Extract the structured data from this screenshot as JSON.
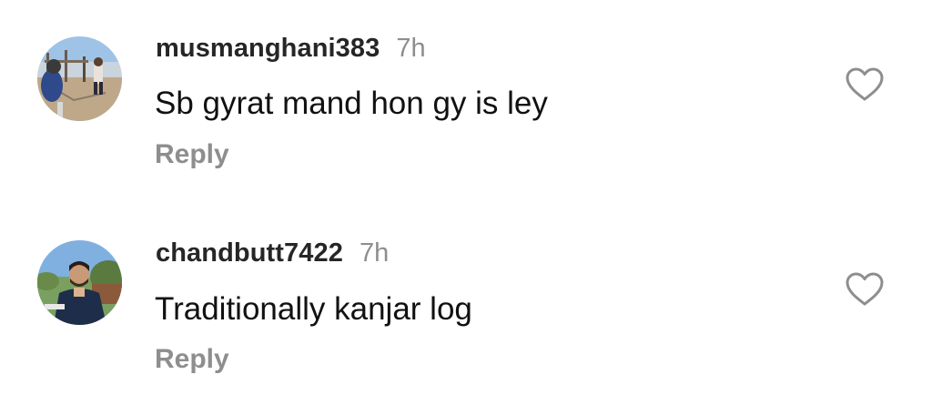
{
  "comments": [
    {
      "username": "musmanghani383",
      "time": "7h",
      "text": "Sb gyrat mand hon gy is ley",
      "reply_label": "Reply",
      "avatar_icon": "playground-photo",
      "like_icon": "heart-outline-icon"
    },
    {
      "username": "chandbutt7422",
      "time": "7h",
      "text": "Traditionally kanjar log",
      "reply_label": "Reply",
      "avatar_icon": "outdoor-portrait-photo",
      "like_icon": "heart-outline-icon"
    }
  ],
  "colors": {
    "username": "#262626",
    "secondary_text": "#8e8e8e",
    "body_text": "#111111",
    "background": "#ffffff"
  }
}
